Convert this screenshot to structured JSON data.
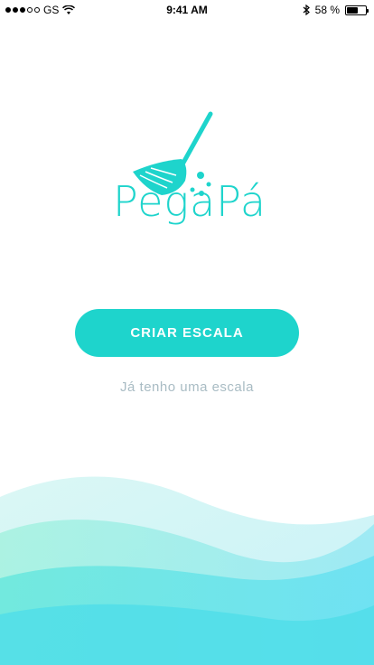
{
  "status_bar": {
    "carrier": "GS",
    "time": "9:41 AM",
    "battery_percent": "58 %",
    "battery_level": 0.58
  },
  "logo": {
    "text": "PegaPá",
    "color": "#1ed4cc"
  },
  "actions": {
    "primary_label": "CRIAR ESCALA",
    "secondary_label": "Já tenho uma escala"
  },
  "colors": {
    "accent": "#1ed4cc",
    "secondary_text": "#a9bcc4"
  }
}
